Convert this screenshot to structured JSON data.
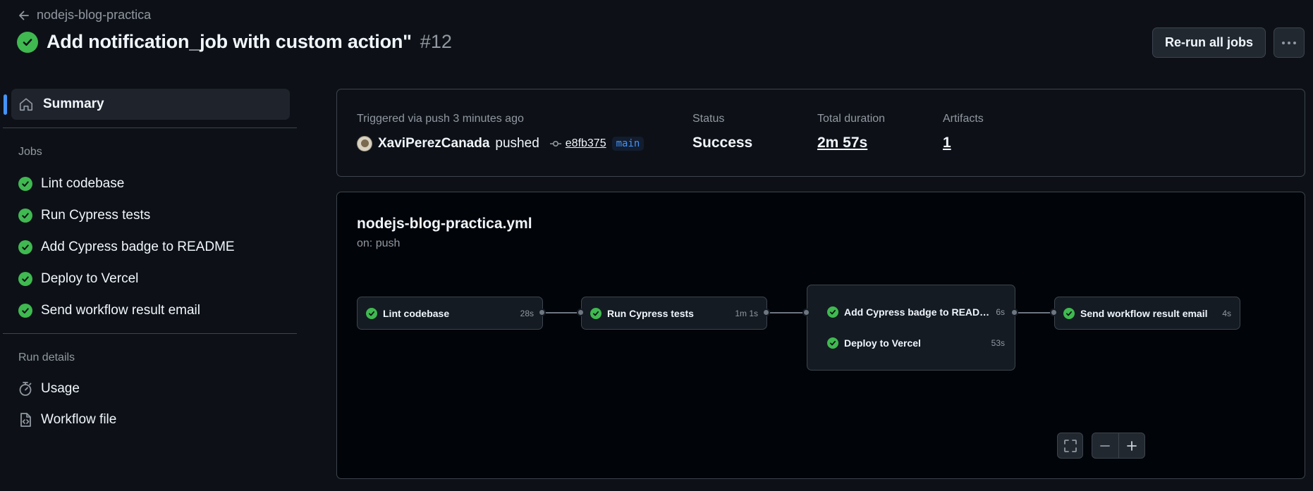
{
  "header": {
    "back_label": "nodejs-blog-practica",
    "title": "Add notification_job with custom action\"",
    "run_number": "#12",
    "rerun_label": "Re-run all jobs"
  },
  "sidebar": {
    "summary_label": "Summary",
    "jobs_heading": "Jobs",
    "jobs": [
      {
        "label": "Lint codebase"
      },
      {
        "label": "Run Cypress tests"
      },
      {
        "label": "Add Cypress badge to README"
      },
      {
        "label": "Deploy to Vercel"
      },
      {
        "label": "Send workflow result email"
      }
    ],
    "run_details_heading": "Run details",
    "usage_label": "Usage",
    "workflow_file_label": "Workflow file"
  },
  "summary": {
    "trigger_text": "Triggered via push 3 minutes ago",
    "actor": "XaviPerezCanada",
    "action": "pushed",
    "commit": "e8fb375",
    "branch": "main",
    "status_label": "Status",
    "status_value": "Success",
    "duration_label": "Total duration",
    "duration_value": "2m 57s",
    "artifacts_label": "Artifacts",
    "artifacts_value": "1"
  },
  "graph": {
    "workflow_name": "nodejs-blog-practica.yml",
    "trigger": "on: push",
    "jobs": [
      {
        "label": "Lint codebase",
        "duration": "28s"
      },
      {
        "label": "Run Cypress tests",
        "duration": "1m 1s"
      },
      {
        "label": "Add Cypress badge to README",
        "duration": "6s"
      },
      {
        "label": "Deploy to Vercel",
        "duration": "53s"
      },
      {
        "label": "Send workflow result email",
        "duration": "4s"
      }
    ]
  },
  "colors": {
    "success": "#3fb950",
    "accent": "#4493f8",
    "background": "#0d1117"
  }
}
